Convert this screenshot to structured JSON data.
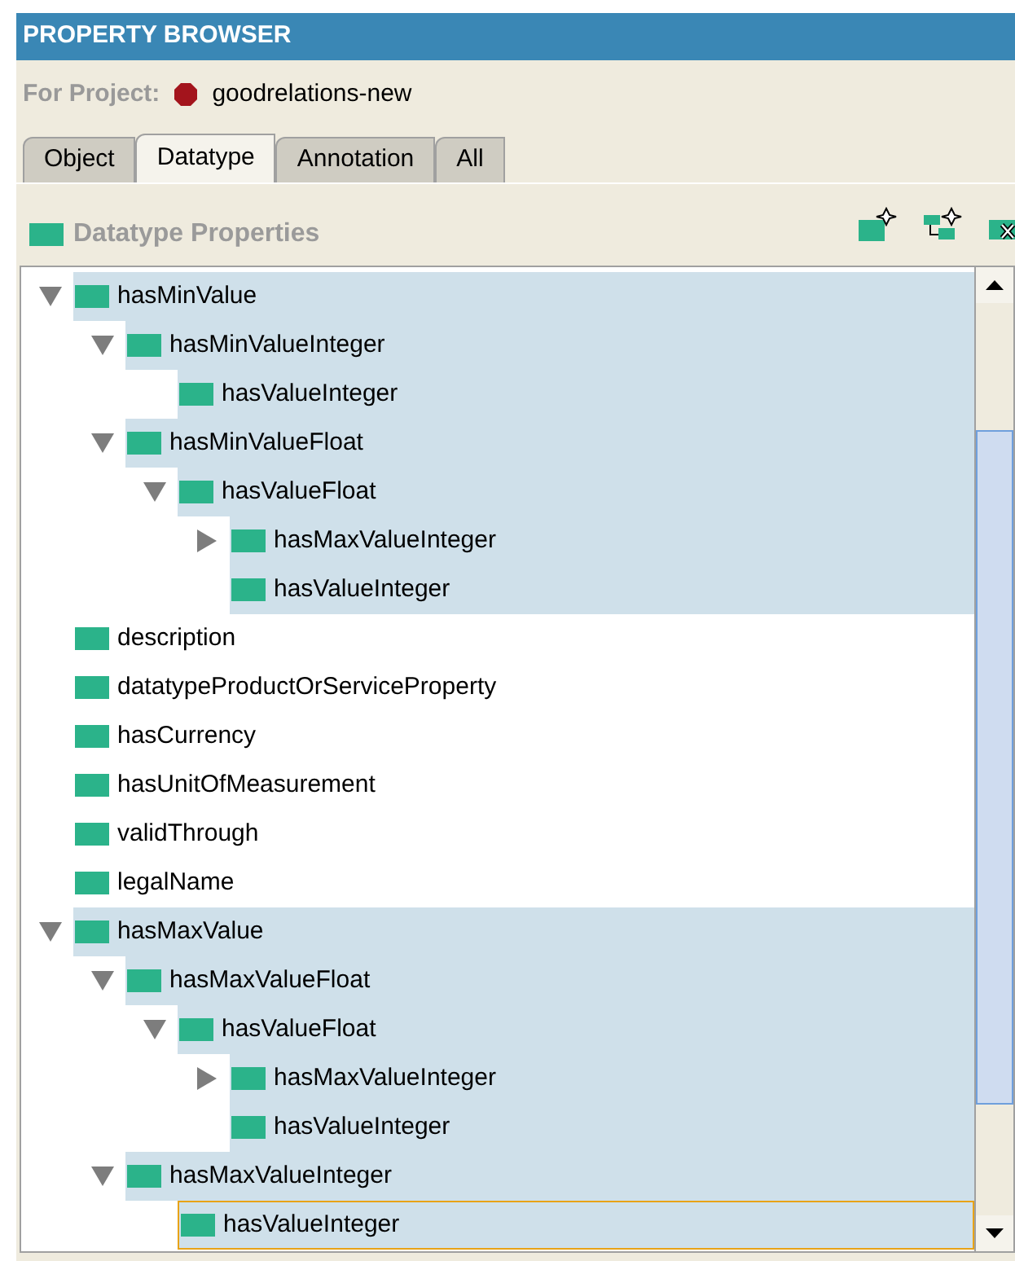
{
  "window": {
    "title": "PROPERTY BROWSER"
  },
  "project": {
    "label": "For Project:",
    "name": "goodrelations-new"
  },
  "tabs": [
    {
      "label": "Object",
      "selected": false
    },
    {
      "label": "Datatype",
      "selected": true
    },
    {
      "label": "Annotation",
      "selected": false
    },
    {
      "label": "All",
      "selected": false
    }
  ],
  "section": {
    "title": "Datatype Properties"
  },
  "tree": [
    {
      "label": "hasMinValue",
      "selected": true,
      "focused": false,
      "expanded": true,
      "children": [
        {
          "label": "hasMinValueInteger",
          "selected": true,
          "focused": false,
          "expanded": true,
          "children": [
            {
              "label": "hasValueInteger",
              "selected": true,
              "focused": false
            }
          ]
        },
        {
          "label": "hasMinValueFloat",
          "selected": true,
          "focused": false,
          "expanded": true,
          "children": [
            {
              "label": "hasValueFloat",
              "selected": true,
              "focused": false,
              "expanded": true,
              "children": [
                {
                  "label": "hasMaxValueInteger",
                  "selected": true,
                  "focused": false,
                  "expanded": false
                },
                {
                  "label": "hasValueInteger",
                  "selected": true,
                  "focused": false
                }
              ]
            }
          ]
        }
      ]
    },
    {
      "label": "description",
      "selected": false,
      "focused": false
    },
    {
      "label": "datatypeProductOrServiceProperty",
      "selected": false,
      "focused": false
    },
    {
      "label": "hasCurrency",
      "selected": false,
      "focused": false
    },
    {
      "label": "hasUnitOfMeasurement",
      "selected": false,
      "focused": false
    },
    {
      "label": "validThrough",
      "selected": false,
      "focused": false
    },
    {
      "label": "legalName",
      "selected": false,
      "focused": false
    },
    {
      "label": "hasMaxValue",
      "selected": true,
      "focused": false,
      "expanded": true,
      "children": [
        {
          "label": "hasMaxValueFloat",
          "selected": true,
          "focused": false,
          "expanded": true,
          "children": [
            {
              "label": "hasValueFloat",
              "selected": true,
              "focused": false,
              "expanded": true,
              "children": [
                {
                  "label": "hasMaxValueInteger",
                  "selected": true,
                  "focused": false,
                  "expanded": false
                },
                {
                  "label": "hasValueInteger",
                  "selected": true,
                  "focused": false
                }
              ]
            }
          ]
        },
        {
          "label": "hasMaxValueInteger",
          "selected": true,
          "focused": false,
          "expanded": true,
          "children": [
            {
              "label": "hasValueInteger",
              "selected": true,
              "focused": true
            }
          ]
        }
      ]
    }
  ]
}
